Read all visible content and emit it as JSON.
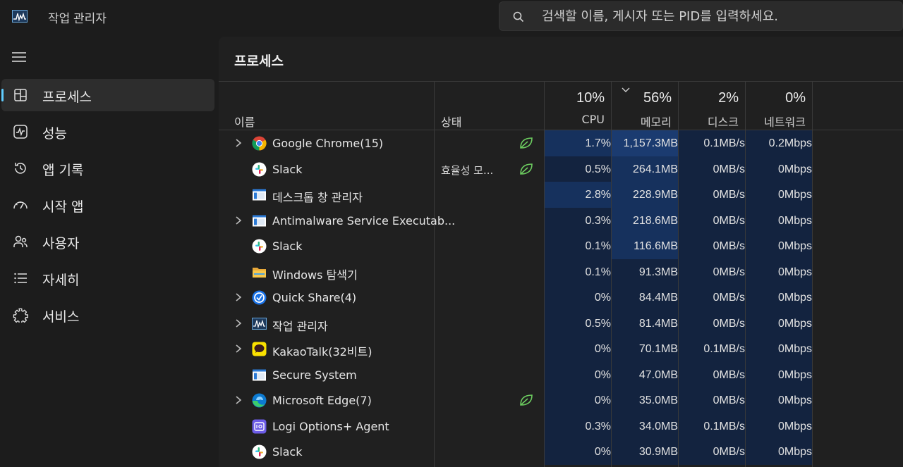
{
  "app": {
    "title": "작업 관리자",
    "search_placeholder": "검색할 이름, 게시자 또는 PID를 입력하세요."
  },
  "sidebar": {
    "items": [
      {
        "label": "프로세스",
        "icon": "processes-icon",
        "active": true
      },
      {
        "label": "성능",
        "icon": "performance-icon",
        "active": false
      },
      {
        "label": "앱 기록",
        "icon": "app-history-icon",
        "active": false
      },
      {
        "label": "시작 앱",
        "icon": "startup-apps-icon",
        "active": false
      },
      {
        "label": "사용자",
        "icon": "users-icon",
        "active": false
      },
      {
        "label": "자세히",
        "icon": "details-icon",
        "active": false
      },
      {
        "label": "서비스",
        "icon": "services-icon",
        "active": false
      }
    ]
  },
  "main": {
    "title": "프로세스",
    "columns": {
      "name": "이름",
      "status": "상태",
      "cpu": {
        "pct": "10%",
        "label": "CPU"
      },
      "memory": {
        "pct": "56%",
        "label": "메모리"
      },
      "disk": {
        "pct": "2%",
        "label": "디스크"
      },
      "network": {
        "pct": "0%",
        "label": "네트워크"
      }
    },
    "rows": [
      {
        "name": "Google Chrome(15)",
        "icon": "chrome-icon",
        "expandable": true,
        "status": "",
        "eco": true,
        "cpu": "1.7%",
        "mem": "1,157.3MB",
        "disk": "0.1MB/s",
        "net": "0.2Mbps",
        "cpu_heat": 2,
        "mem_heat": 3
      },
      {
        "name": "Slack",
        "icon": "slack-icon",
        "expandable": false,
        "status": "효율성 모...",
        "eco": true,
        "cpu": "0.5%",
        "mem": "264.1MB",
        "disk": "0MB/s",
        "net": "0Mbps",
        "cpu_heat": 1,
        "mem_heat": 2
      },
      {
        "name": "데스크톱 창 관리자",
        "icon": "window-app-icon",
        "expandable": false,
        "status": "",
        "eco": false,
        "cpu": "2.8%",
        "mem": "228.9MB",
        "disk": "0MB/s",
        "net": "0Mbps",
        "cpu_heat": 2,
        "mem_heat": 2
      },
      {
        "name": "Antimalware Service Executab...",
        "icon": "window-app-icon",
        "expandable": true,
        "status": "",
        "eco": false,
        "cpu": "0.3%",
        "mem": "218.6MB",
        "disk": "0MB/s",
        "net": "0Mbps",
        "cpu_heat": 1,
        "mem_heat": 2
      },
      {
        "name": "Slack",
        "icon": "slack-icon",
        "expandable": false,
        "status": "",
        "eco": false,
        "cpu": "0.1%",
        "mem": "116.6MB",
        "disk": "0MB/s",
        "net": "0Mbps",
        "cpu_heat": 1,
        "mem_heat": 2
      },
      {
        "name": "Windows 탐색기",
        "icon": "folder-icon",
        "expandable": false,
        "status": "",
        "eco": false,
        "cpu": "0.1%",
        "mem": "91.3MB",
        "disk": "0MB/s",
        "net": "0Mbps",
        "cpu_heat": 1,
        "mem_heat": 1
      },
      {
        "name": "Quick Share(4)",
        "icon": "quick-share-icon",
        "expandable": true,
        "status": "",
        "eco": false,
        "cpu": "0%",
        "mem": "84.4MB",
        "disk": "0MB/s",
        "net": "0Mbps",
        "cpu_heat": 1,
        "mem_heat": 1
      },
      {
        "name": "작업 관리자",
        "icon": "task-manager-icon",
        "expandable": true,
        "status": "",
        "eco": false,
        "cpu": "0.5%",
        "mem": "81.4MB",
        "disk": "0MB/s",
        "net": "0Mbps",
        "cpu_heat": 1,
        "mem_heat": 1
      },
      {
        "name": "KakaoTalk(32비트)",
        "icon": "kakaotalk-icon",
        "expandable": true,
        "status": "",
        "eco": false,
        "cpu": "0%",
        "mem": "70.1MB",
        "disk": "0.1MB/s",
        "net": "0Mbps",
        "cpu_heat": 1,
        "mem_heat": 1
      },
      {
        "name": "Secure System",
        "icon": "window-app-icon",
        "expandable": false,
        "status": "",
        "eco": false,
        "cpu": "0%",
        "mem": "47.0MB",
        "disk": "0MB/s",
        "net": "0Mbps",
        "cpu_heat": 1,
        "mem_heat": 1
      },
      {
        "name": "Microsoft Edge(7)",
        "icon": "edge-icon",
        "expandable": true,
        "status": "",
        "eco": true,
        "cpu": "0%",
        "mem": "35.0MB",
        "disk": "0MB/s",
        "net": "0Mbps",
        "cpu_heat": 1,
        "mem_heat": 1
      },
      {
        "name": "Logi Options+ Agent",
        "icon": "logi-icon",
        "expandable": false,
        "status": "",
        "eco": false,
        "cpu": "0.3%",
        "mem": "34.0MB",
        "disk": "0.1MB/s",
        "net": "0Mbps",
        "cpu_heat": 1,
        "mem_heat": 1
      },
      {
        "name": "Slack",
        "icon": "slack-icon",
        "expandable": false,
        "status": "",
        "eco": false,
        "cpu": "0%",
        "mem": "30.9MB",
        "disk": "0MB/s",
        "net": "0Mbps",
        "cpu_heat": 1,
        "mem_heat": 1
      }
    ]
  },
  "colors": {
    "accent": "#60cdff",
    "heat_1": "#13233f",
    "heat_2": "#16315d",
    "heat_3": "#1b3b70",
    "eco_green": "#6ccb5f"
  }
}
